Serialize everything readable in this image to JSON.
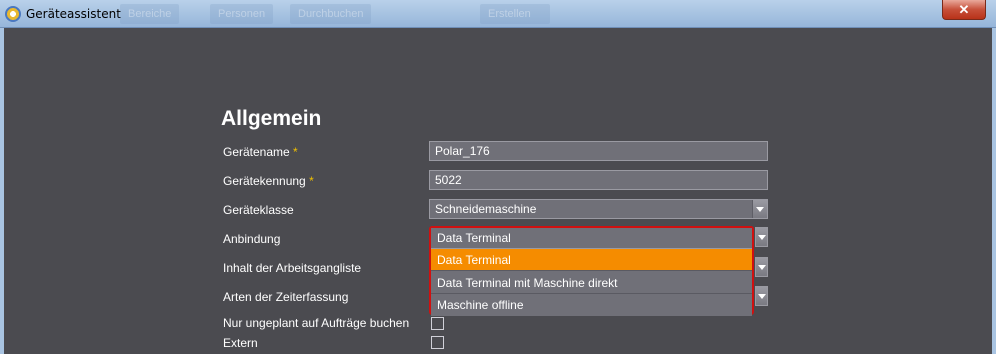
{
  "window": {
    "title": "Geräteassistent",
    "close_glyph": "✕",
    "background_nav": [
      "Bereiche ▾",
      "Personen",
      "Durchbuchen ▾",
      "Erstellen"
    ]
  },
  "form": {
    "section_title": "Allgemein",
    "required_marker": "*",
    "fields": {
      "geraetename": {
        "label": "Gerätename",
        "value": "Polar_176"
      },
      "geraetekennung": {
        "label": "Gerätekennung",
        "value": "5022"
      },
      "geraeteklasse": {
        "label": "Geräteklasse",
        "value": "Schneidemaschine"
      },
      "anbindung": {
        "label": "Anbindung",
        "value": "Data Terminal"
      },
      "arbeitsgangliste": {
        "label": "Inhalt der Arbeitsgangliste"
      },
      "zeiterfassung": {
        "label": "Arten der Zeiterfassung"
      },
      "nur_ungeplant": {
        "label": "Nur ungeplant auf Aufträge buchen",
        "checked": false
      },
      "extern": {
        "label": "Extern",
        "checked": false
      }
    },
    "anbindung_options": [
      "Data Terminal",
      "Data Terminal mit Maschine direkt",
      "Maschine offline"
    ],
    "anbindung_selected_index": 0
  },
  "colors": {
    "background": "#4b4b50",
    "field_bg": "#707078",
    "highlight": "#f58c00",
    "required": "#f0c000",
    "focus_outline": "#d01010"
  }
}
